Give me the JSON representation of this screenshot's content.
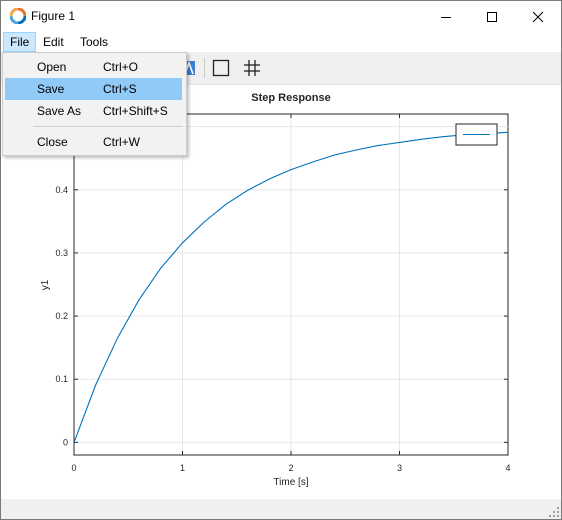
{
  "window": {
    "title": "Figure 1",
    "accent": "#0072bd"
  },
  "menubar": {
    "items": [
      {
        "label": "File",
        "active": true
      },
      {
        "label": "Edit"
      },
      {
        "label": "Tools"
      }
    ]
  },
  "file_menu": {
    "items": [
      {
        "label": "Open",
        "shortcut": "Ctrl+O"
      },
      {
        "label": "Save",
        "shortcut": "Ctrl+S",
        "highlighted": true
      },
      {
        "label": "Save As",
        "shortcut": "Ctrl+Shift+S"
      },
      {
        "label": "Close",
        "shortcut": "Ctrl+W"
      }
    ]
  },
  "toolbar": {
    "icons": [
      "text-a-icon",
      "box-icon",
      "grid-icon"
    ]
  },
  "chart_data": {
    "type": "line",
    "title": "Step Response",
    "xlabel": "Time [s]",
    "ylabel": "y1",
    "xlim": [
      0,
      4
    ],
    "ylim": [
      -0.02,
      0.52
    ],
    "xticks": [
      "0",
      "1",
      "2",
      "3",
      "4"
    ],
    "yticks": [
      "0",
      "0.1",
      "0.2",
      "0.3",
      "0.4"
    ],
    "grid": true,
    "legend": "top-right",
    "series": [
      {
        "color": "#0072bd",
        "x": [
          0,
          0.2,
          0.4,
          0.6,
          0.8,
          1.0,
          1.2,
          1.4,
          1.6,
          1.8,
          2.0,
          2.2,
          2.4,
          2.6,
          2.8,
          3.0,
          3.2,
          3.4,
          3.6,
          3.8,
          4.0
        ],
        "y": [
          0,
          0.091,
          0.165,
          0.226,
          0.276,
          0.316,
          0.349,
          0.377,
          0.399,
          0.417,
          0.432,
          0.444,
          0.455,
          0.463,
          0.47,
          0.475,
          0.48,
          0.484,
          0.487,
          0.489,
          0.491
        ]
      }
    ]
  }
}
